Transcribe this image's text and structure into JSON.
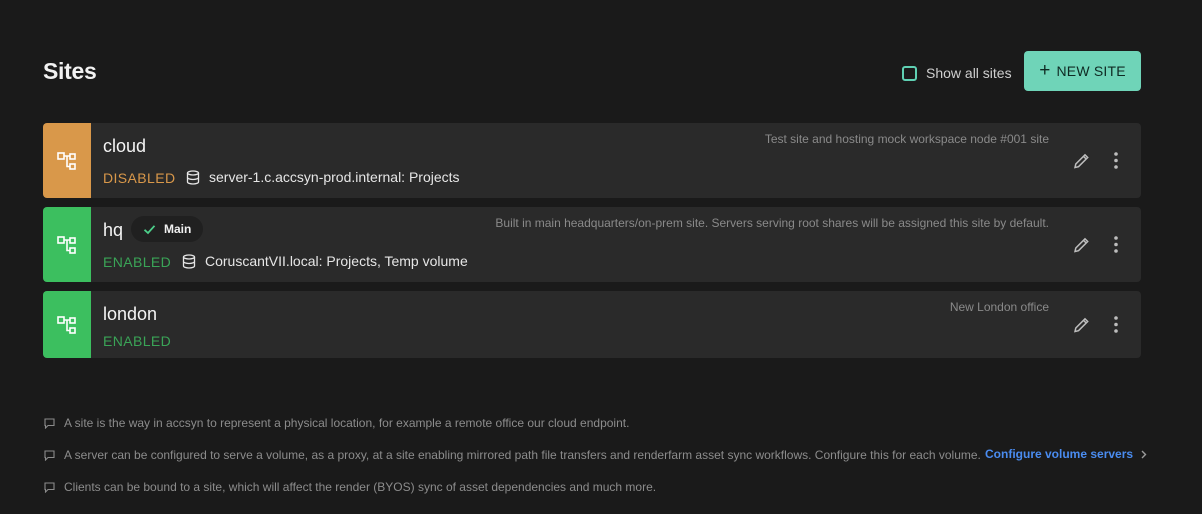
{
  "page": {
    "title": "Sites"
  },
  "toolbar": {
    "show_all_label": "Show all sites",
    "show_all_checked": false,
    "new_site_label": "NEW SITE"
  },
  "sites": [
    {
      "name": "cloud",
      "description": "Test site and hosting mock workspace node #001 site",
      "status": "DISABLED",
      "status_color": "#d9984a",
      "icon_bg": "#d9984a",
      "server": "server-1.c.accsyn-prod.internal: Projects",
      "main": false
    },
    {
      "name": "hq",
      "description": "Built in main headquarters/on-prem site. Servers serving root shares will be assigned this site by default.",
      "status": "ENABLED",
      "status_color": "#3aa457",
      "icon_bg": "#3cbf5f",
      "server": "CoruscantVII.local: Projects, Temp volume",
      "main": true,
      "main_label": "Main"
    },
    {
      "name": "london",
      "description": "New London office",
      "status": "ENABLED",
      "status_color": "#3aa457",
      "icon_bg": "#3cbf5f",
      "server": "",
      "main": false
    }
  ],
  "notes": [
    "A site is the way in accsyn to represent a physical location, for example a remote office our cloud endpoint.",
    "A server can be configured to serve a volume, as a proxy, at a site enabling mirrored path file transfers and renderfarm asset sync workflows. Configure this for each volume.",
    "Clients can be bound to a site, which will affect the render (BYOS) sync of asset dependencies and much more."
  ],
  "links": {
    "configure_volume_servers": "Configure volume servers"
  },
  "icons": {
    "site": "site-hierarchy-icon",
    "server": "database-icon",
    "edit": "pencil-icon",
    "more": "more-vertical-icon",
    "check": "check-icon",
    "note": "comment-icon",
    "chevron": "chevron-right-icon"
  }
}
